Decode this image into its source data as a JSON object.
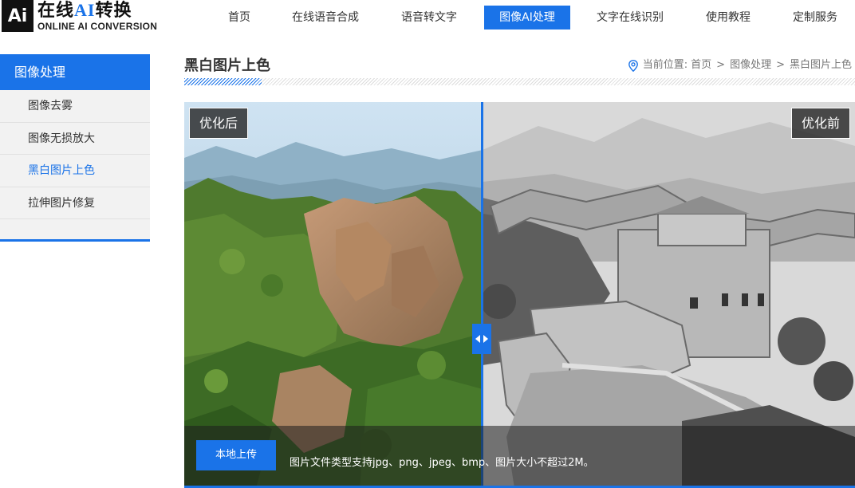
{
  "logo": {
    "mark": "Ai",
    "title_prefix": "在线",
    "title_ai": "AI",
    "title_suffix": "转换",
    "subtitle": "ONLINE AI CONVERSION"
  },
  "nav": {
    "items": [
      {
        "label": "首页"
      },
      {
        "label": "在线语音合成"
      },
      {
        "label": "语音转文字"
      },
      {
        "label": "图像AI处理"
      },
      {
        "label": "文字在线识别"
      },
      {
        "label": "使用教程"
      },
      {
        "label": "定制服务"
      }
    ],
    "active_index": 3
  },
  "sidebar": {
    "heading": "图像处理",
    "items": [
      {
        "label": "图像去雾"
      },
      {
        "label": "图像无损放大"
      },
      {
        "label": "黑白图片上色"
      },
      {
        "label": "拉伸图片修复"
      }
    ],
    "active_index": 2
  },
  "page": {
    "title": "黑白图片上色",
    "breadcrumb_prefix": "当前位置:",
    "breadcrumb": [
      "首页",
      "图像处理",
      "黑白图片上色"
    ],
    "breadcrumb_separator": ">"
  },
  "compare": {
    "label_after": "优化后",
    "label_before": "优化前",
    "upload_label": "本地上传",
    "hint": "图片文件类型支持jpg、png、jpeg、bmp、图片大小不超过2M。",
    "slider_position": 0.445
  },
  "colors": {
    "accent": "#1a73e8"
  },
  "icons": {
    "location": "location-pin-icon",
    "handle": "left-right-arrows-icon"
  }
}
